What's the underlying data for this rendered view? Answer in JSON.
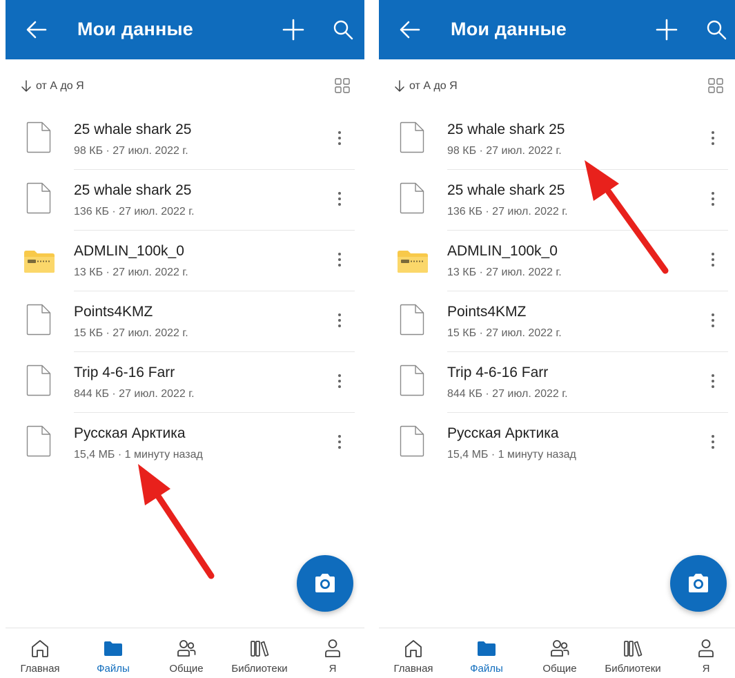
{
  "appbar": {
    "title": "Мои данные"
  },
  "sort": {
    "label": "от А до Я"
  },
  "files": [
    {
      "name": "25 whale shark 25",
      "meta": "98 КБ · 27 июл. 2022 г.",
      "type": "file"
    },
    {
      "name": "25 whale shark 25",
      "meta": "136 КБ · 27 июл. 2022 г.",
      "type": "file"
    },
    {
      "name": "ADMLIN_100k_0",
      "meta": "13 КБ · 27 июл. 2022 г.",
      "type": "zip"
    },
    {
      "name": "Points4KMZ",
      "meta": "15 КБ · 27 июл. 2022 г.",
      "type": "file"
    },
    {
      "name": "Trip 4-6-16 Farr",
      "meta": "844 КБ · 27 июл. 2022 г.",
      "type": "file"
    },
    {
      "name": "Русская Арктика",
      "meta": "15,4 МБ · 1 минуту назад",
      "type": "file"
    }
  ],
  "nav": [
    {
      "label": "Главная",
      "icon": "home-icon"
    },
    {
      "label": "Файлы",
      "icon": "folder-icon",
      "active": true
    },
    {
      "label": "Общие",
      "icon": "people-icon"
    },
    {
      "label": "Библиотеки",
      "icon": "library-icon"
    },
    {
      "label": "Я",
      "icon": "person-icon"
    }
  ],
  "colors": {
    "accent": "#0f6cbd",
    "annotation_arrow": "#e8211c",
    "zip_folder": "#f8c94a"
  }
}
